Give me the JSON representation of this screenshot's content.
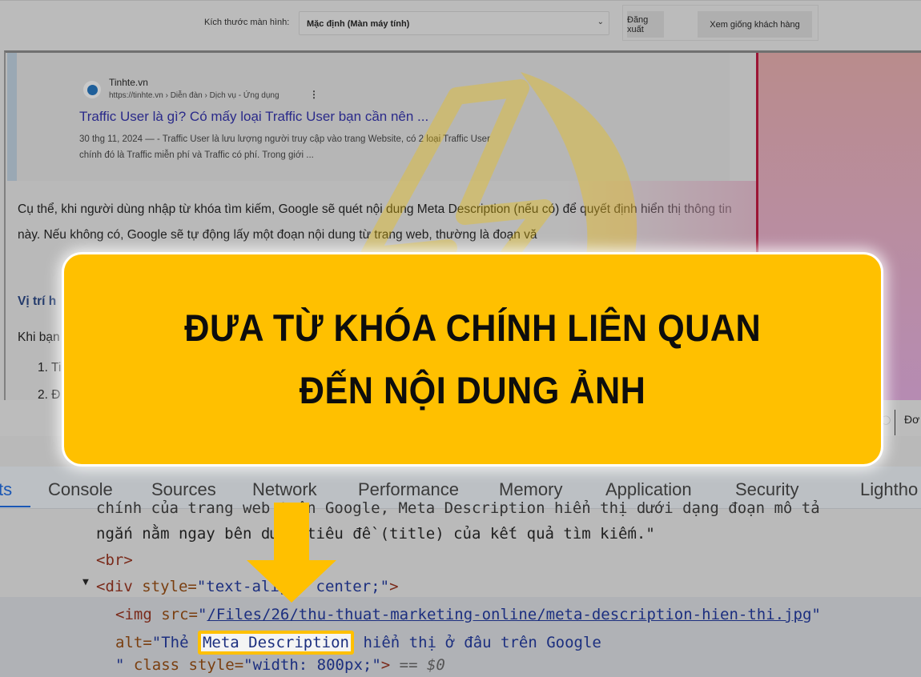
{
  "admin_bar": {
    "screen_size_label": "Kích thước màn hình:",
    "screen_size_value": "Mặc định (Màn máy tính)",
    "logout_button": "Đăng xuất",
    "preview_button": "Xem giống khách hàng"
  },
  "serp_result": {
    "site_name": "Tinhte.vn",
    "breadcrumb_url": "https://tinhte.vn › Diễn đàn › Dịch vụ - Ứng dụng",
    "title": "Traffic User là gì? Có mấy loại Traffic User bạn cần nên ...",
    "snippet_line1": "30 thg 11, 2024 — - Traffic User là lưu lượng người truy cập vào trang Website, có 2 loại Traffic User",
    "snippet_line2": "chính đó là Traffic miễn phí và Traffic có phí. Trong giới ..."
  },
  "article": {
    "paragraph1": "Cụ thể, khi người dùng nhập từ khóa tìm kiếm, Google sẽ quét nội dung Meta Description (nếu có) để quyết định hiển thị thông tin này. Nếu không có, Google sẽ tự động lấy một đoạn nội dung từ trang web, thường là đoạn vă",
    "heading": "Vị trí h",
    "paragraph2": "Khi bạn",
    "list_item1": "1. Ti",
    "list_item2": "2. Đ"
  },
  "right_strip": {
    "cut_text": "Đơ"
  },
  "devtools": {
    "tabs": [
      "ts",
      "Console",
      "Sources",
      "Network",
      "Performance",
      "Memory",
      "Application",
      "Security",
      "Lightho"
    ],
    "active_tab_index": 0,
    "code": {
      "line0": "chính của trang web trên Google, Meta Description hiển thị dưới dạng đoạn mô tả",
      "line1": "ngắn nằm ngay bên dưới tiêu đề (title) của kết quả tìm kiếm.\"",
      "line2": "<br>",
      "div_open": "<div",
      "div_attr": " style=",
      "div_val": "\"text-align: center;\"",
      "div_close": ">",
      "img_open": "<img",
      "img_src_attr": " src=",
      "img_src_q": "\"",
      "img_src_val": "/Files/26/thu-thuat-marketing-online/meta-description-hien-thi.jpg",
      "alt_attr": "alt=",
      "alt_val_start": "\"Thẻ ",
      "alt_highlight": "Meta Description",
      "alt_val_end": " hiển thị ở đâu trên Google",
      "class_line_q": "\" ",
      "class_attr": "class style=",
      "class_val": "\"width: 800px;\"",
      "class_close": ">",
      "eq": " == ",
      "dollar": "$0"
    }
  },
  "banner": {
    "line1": "ĐƯA TỪ KHÓA CHÍNH LIÊN QUAN",
    "line2": "ĐẾN NỘI DUNG ẢNH",
    "color": "#ffc000"
  }
}
